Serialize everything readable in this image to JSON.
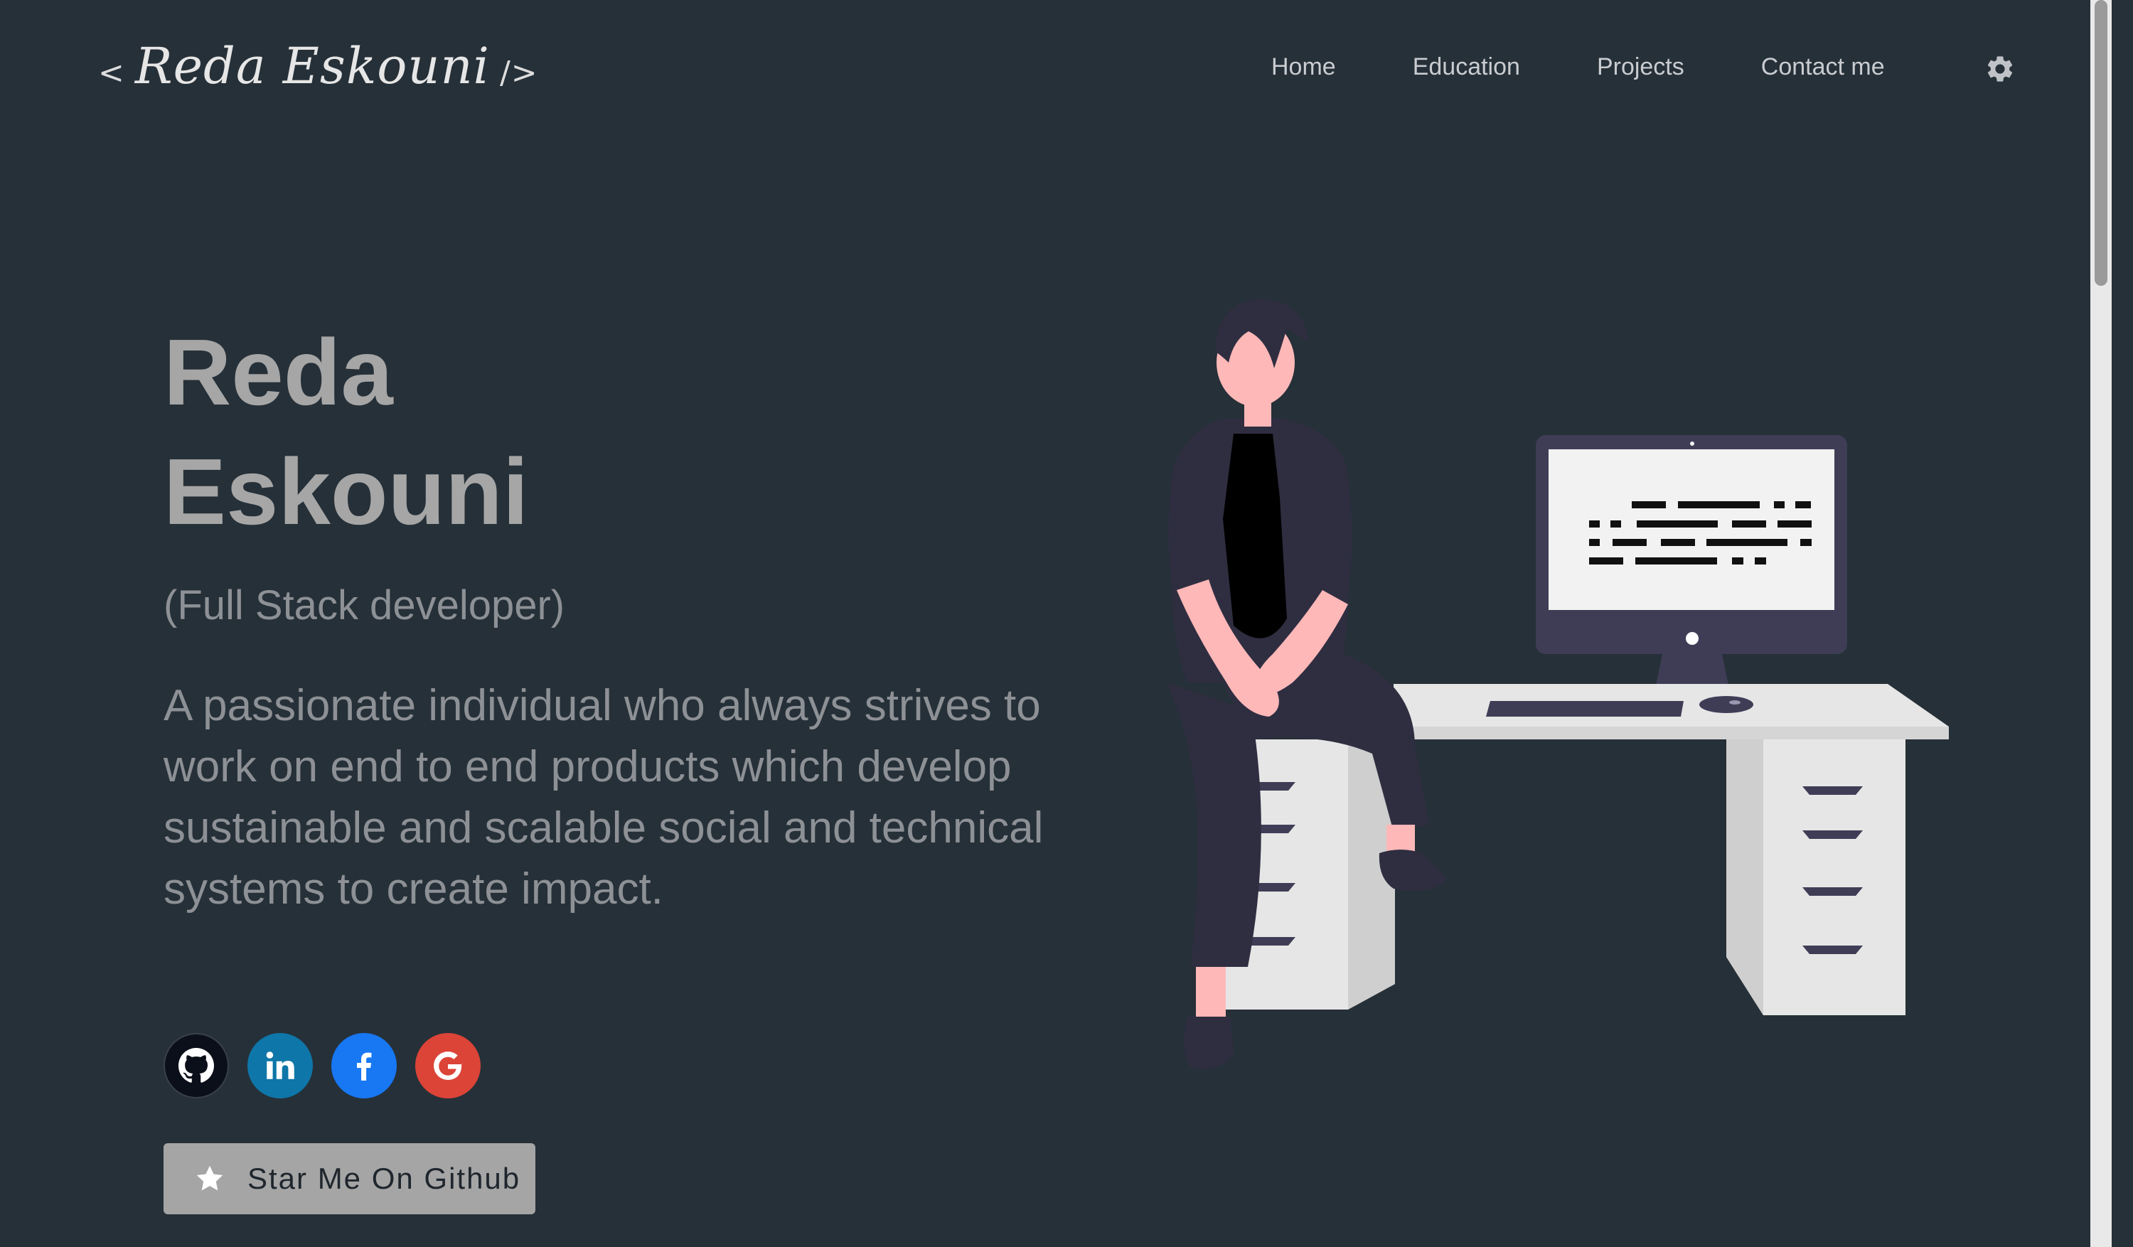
{
  "header": {
    "logo_left": "<",
    "logo_name": "Reda Eskouni",
    "logo_right": "/>",
    "nav": [
      "Home",
      "Education",
      "Projects",
      "Contact me"
    ]
  },
  "hero": {
    "name_line1": "Reda",
    "name_line2": "Eskouni",
    "role": "(Full Stack developer)",
    "description": "A passionate individual who always strives to work on end to end products which develop sustainable and scalable social and technical systems to create impact."
  },
  "social": [
    "github-icon",
    "linkedin-icon",
    "facebook-icon",
    "google-icon"
  ],
  "button": {
    "label": "Star Me On Github"
  },
  "colors": {
    "background": "#263038",
    "name": "#a6a6a6",
    "text": "#8d9196",
    "button": "#a5a5a5",
    "linkedin": "#0e76a8",
    "facebook": "#1877f2",
    "google": "#db4437"
  }
}
